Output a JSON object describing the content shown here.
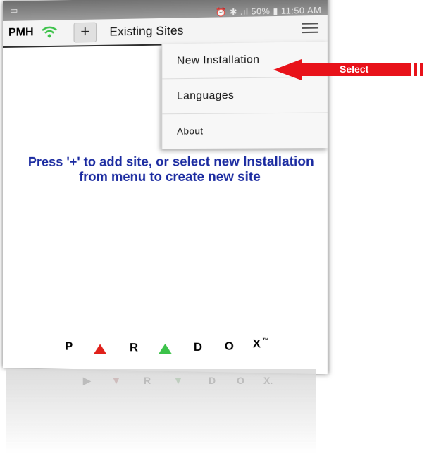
{
  "status_bar": {
    "text": "⏰ ✱ .ıl 50% ▮ 11:50 AM"
  },
  "app_bar": {
    "brand": "PMH",
    "add_button": "+",
    "title": "Existing Sites"
  },
  "menu": {
    "items": [
      {
        "label": "New Installation"
      },
      {
        "label": "Languages"
      },
      {
        "label": "About"
      }
    ]
  },
  "hint": "Press '+' to add site, or select new Installation from menu to create new site",
  "logo": {
    "letters": [
      "P",
      "R",
      "D",
      "O",
      "X"
    ],
    "trademark": "™"
  },
  "annotation": {
    "label": "Select"
  },
  "colors": {
    "accent_green": "#3cc24a",
    "logo_red": "#e0201a",
    "hint_blue": "#1a2aa0",
    "arrow_red": "#e8121a"
  }
}
